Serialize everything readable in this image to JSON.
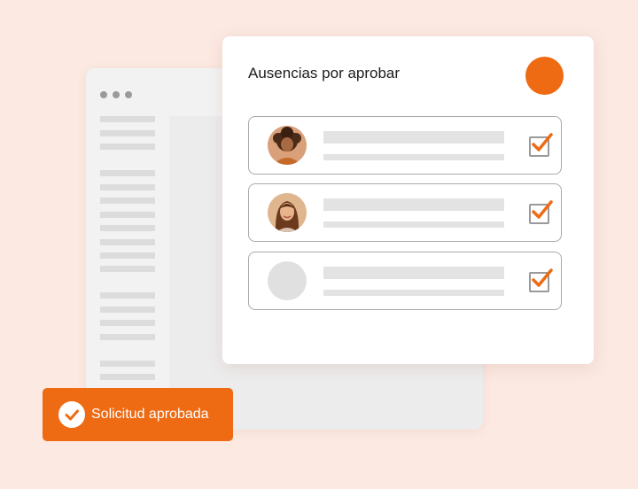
{
  "panel": {
    "title": "Ausencias por aprobar",
    "status_color": "#ee6b14",
    "requests": [
      {
        "avatar": "person-curly-hair-avatar",
        "approved": true
      },
      {
        "avatar": "person-long-hair-avatar",
        "approved": true
      },
      {
        "avatar": "placeholder-avatar",
        "approved": true
      }
    ]
  },
  "toast": {
    "label": "Solicitud aprobada",
    "icon": "check-circle-icon"
  },
  "colors": {
    "accent": "#ee6b14",
    "background": "#fbe9e2"
  }
}
